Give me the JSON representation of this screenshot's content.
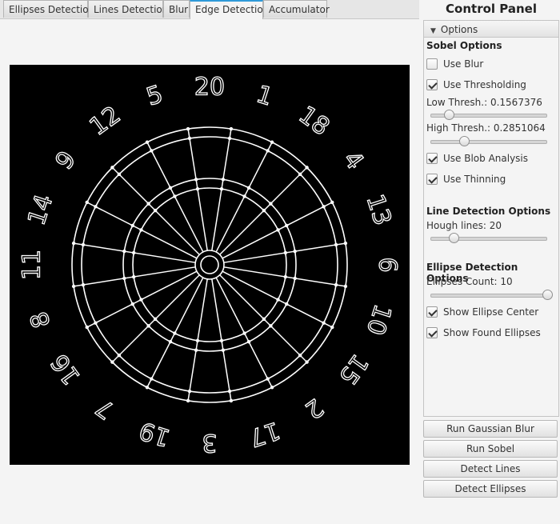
{
  "tabs": [
    {
      "label": "Ellipses Detection",
      "active": false
    },
    {
      "label": "Lines Detection",
      "active": false
    },
    {
      "label": "Blur",
      "active": false
    },
    {
      "label": "Edge Detection",
      "active": true
    },
    {
      "label": "Accumulator",
      "active": false
    }
  ],
  "image": {
    "numbers": [
      "20",
      "1",
      "18",
      "4",
      "13",
      "6",
      "10",
      "15",
      "2",
      "17",
      "3",
      "19",
      "7",
      "16",
      "8",
      "11",
      "14",
      "9",
      "12",
      "5"
    ],
    "colors": {
      "background": "#000000",
      "edges": "#ffffff"
    }
  },
  "control_panel": {
    "title": "Control Panel",
    "options_header": "Options",
    "sobel": {
      "title": "Sobel Options",
      "use_blur": {
        "label": "Use Blur",
        "checked": false
      },
      "use_thresholding": {
        "label": "Use Thresholding",
        "checked": true
      },
      "low_thresh_label": "Low Thresh.: 0.1567376",
      "low_thresh_value": 0.1567376,
      "high_thresh_label": "High Thresh.: 0.2851064",
      "high_thresh_value": 0.2851064,
      "use_blob": {
        "label": "Use Blob Analysis",
        "checked": true
      },
      "use_thinning": {
        "label": "Use Thinning",
        "checked": true
      }
    },
    "line_detection": {
      "title": "Line Detection Options",
      "hough_label": "Hough lines: 20",
      "hough_value": 20
    },
    "ellipse_detection": {
      "title": "Ellipse Detection Options",
      "count_label": "Ellipses Count: 10",
      "count_value": 10,
      "show_center": {
        "label": "Show Ellipse Center",
        "checked": true
      },
      "show_found": {
        "label": "Show Found Ellipses",
        "checked": true
      }
    },
    "buttons": {
      "run_blur": "Run Gaussian Blur",
      "run_sobel": "Run Sobel",
      "detect_lines": "Detect Lines",
      "detect_ellipses": "Detect Ellipses"
    }
  }
}
